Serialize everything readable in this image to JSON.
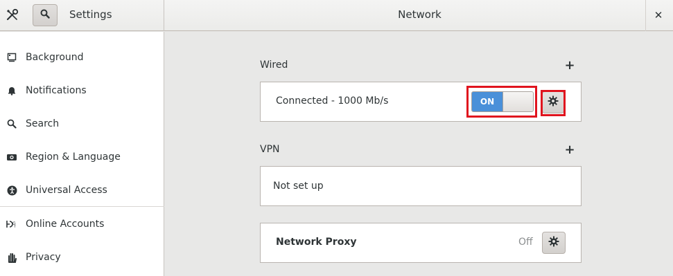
{
  "header": {
    "app_title": "Settings",
    "panel_title": "Network",
    "close_glyph": "✕",
    "icons": [
      "settings-tools-icon",
      "search-icon",
      "close-icon"
    ]
  },
  "sidebar": {
    "items": [
      {
        "label": "Background",
        "icon": "background-icon"
      },
      {
        "label": "Notifications",
        "icon": "bell-icon"
      },
      {
        "label": "Search",
        "icon": "search-icon"
      },
      {
        "label": "Region & Language",
        "icon": "camera-icon"
      },
      {
        "label": "Universal Access",
        "icon": "accessibility-icon"
      },
      {
        "label": "Online Accounts",
        "icon": "online-accounts-icon"
      },
      {
        "label": "Privacy",
        "icon": "hand-icon"
      }
    ]
  },
  "main": {
    "wired": {
      "title": "Wired",
      "add_glyph": "+",
      "status": "Connected - 1000 Mb/s",
      "switch_label": "ON",
      "switch_state": true
    },
    "vpn": {
      "title": "VPN",
      "add_glyph": "+",
      "status": "Not set up"
    },
    "proxy": {
      "title": "Network Proxy",
      "status": "Off"
    }
  },
  "colors": {
    "accent": "#4a90d9",
    "highlight": "#e0141e",
    "background": "#e8e8e7"
  }
}
